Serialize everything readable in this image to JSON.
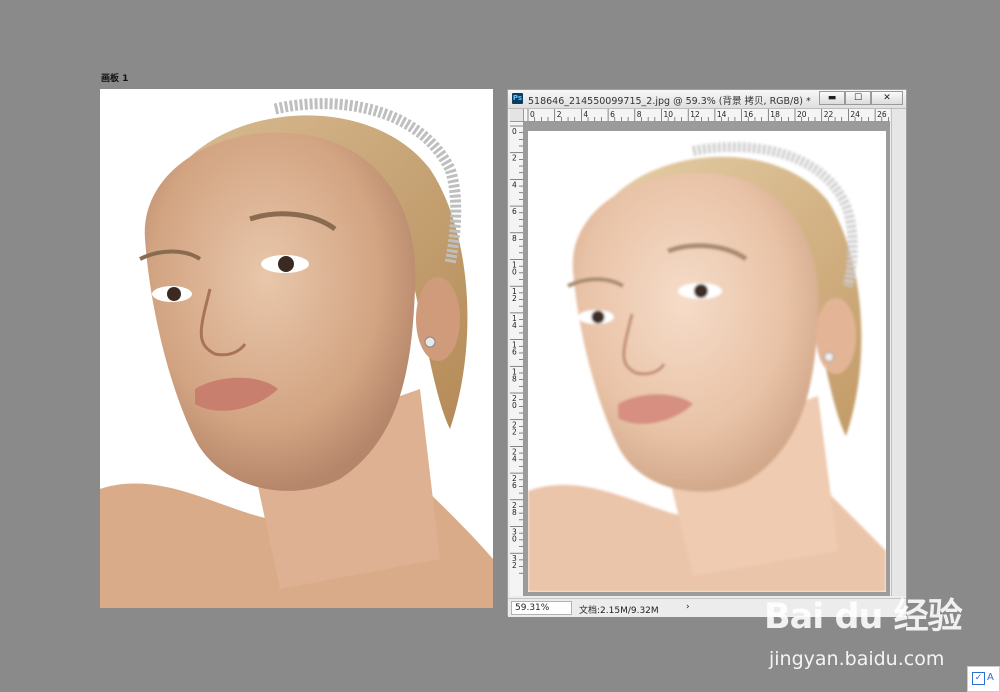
{
  "artboard": {
    "label": "画板 1"
  },
  "document": {
    "ps_icon_text": "Ps",
    "title": "518646_214550099715_2.jpg @ 59.3% (背景 拷贝, RGB/8) *",
    "buttons": {
      "minimize": "▬",
      "maximize": "☐",
      "close": "✕"
    },
    "h_ruler_ticks": [
      "0",
      "2",
      "4",
      "6",
      "8",
      "10",
      "12",
      "14",
      "16",
      "18",
      "20",
      "22",
      "24",
      "26"
    ],
    "v_ruler_ticks": [
      "0",
      "2",
      "4",
      "6",
      "8",
      "10",
      "12",
      "14",
      "16",
      "18",
      "20",
      "22",
      "24",
      "26",
      "28",
      "30",
      "32"
    ],
    "status": {
      "zoom": "59.31%",
      "doc_info": "文档:2.15M/9.32M",
      "arrow": "›"
    }
  },
  "watermark": {
    "logo": "Bai du 经验",
    "url": "jingyan.baidu.com"
  },
  "corner_widget": {
    "check": "✓",
    "letter": "A"
  }
}
